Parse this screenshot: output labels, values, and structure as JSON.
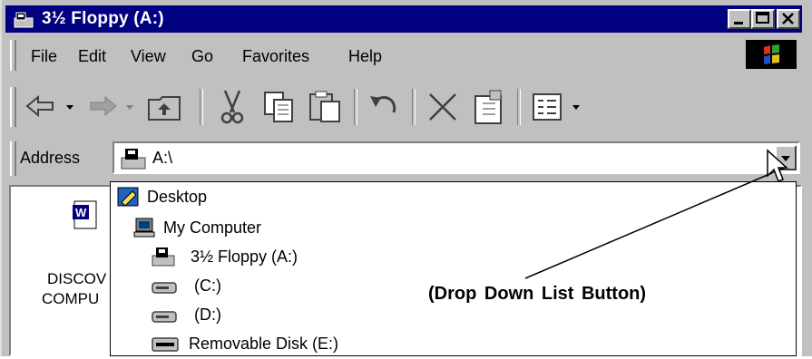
{
  "window": {
    "title": "3½ Floppy (A:)"
  },
  "menu": [
    {
      "label": "File"
    },
    {
      "label": "Edit"
    },
    {
      "label": "View"
    },
    {
      "label": "Go"
    },
    {
      "label": "Favorites"
    },
    {
      "label": "Help"
    }
  ],
  "toolbar": {
    "icons": [
      "back-arrow-icon",
      "forward-arrow-icon",
      "up-folder-icon",
      "cut-icon",
      "copy-icon",
      "paste-icon",
      "undo-icon",
      "delete-icon",
      "properties-icon",
      "views-icon"
    ]
  },
  "address": {
    "label": "Address",
    "value": "A:\\"
  },
  "file_view": {
    "items": [
      {
        "label_line1": "DISCOV",
        "label_line2": "COMPU"
      }
    ]
  },
  "dropdown": {
    "items": [
      {
        "label": "Desktop",
        "icon": "desktop-icon"
      },
      {
        "label": "My Computer",
        "icon": "my-computer-icon"
      },
      {
        "label": "3½ Floppy (A:)",
        "icon": "floppy-drive-icon"
      },
      {
        "label": "(C:)",
        "icon": "hard-drive-icon"
      },
      {
        "label": "(D:)",
        "icon": "hard-drive-icon"
      },
      {
        "label": "Removable Disk (E:)",
        "icon": "removable-disk-icon"
      }
    ]
  },
  "annotation": {
    "text": "(Drop Down List Button)"
  },
  "colors": {
    "titlebar": "#000080",
    "chrome": "#c0c0c0"
  }
}
